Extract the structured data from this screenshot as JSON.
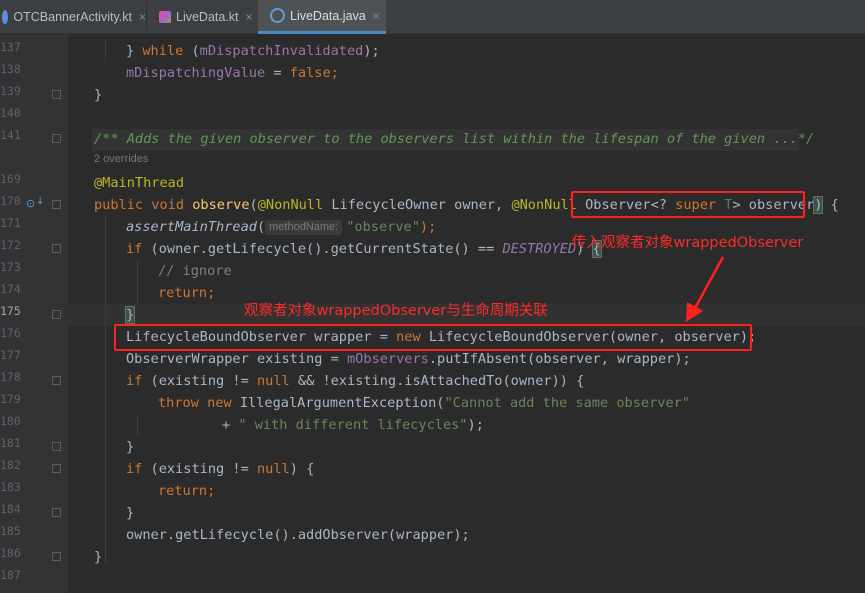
{
  "tabs": [
    {
      "label": "OTCBannerActivity.kt",
      "icon": "kotlin-file-icon",
      "active": false
    },
    {
      "label": "LiveData.kt",
      "icon": "kotlin-file-icon",
      "active": false
    },
    {
      "label": "LiveData.java",
      "icon": "java-class-icon",
      "active": true
    }
  ],
  "tab_close_glyph": "×",
  "line_numbers": [
    "137",
    "138",
    "139",
    "140",
    "141",
    "",
    "169",
    "170",
    "171",
    "172",
    "173",
    "174",
    "175",
    "176",
    "177",
    "178",
    "179",
    "180",
    "181",
    "182",
    "183",
    "184",
    "185",
    "186",
    "187"
  ],
  "current_line": "175",
  "code": {
    "l137": [
      "} ",
      "while",
      " (",
      "mDispatchInvalidated",
      ");"
    ],
    "l138": [
      "mDispatchingValue",
      " = ",
      "false",
      ";"
    ],
    "l139": "}",
    "l141": "/** Adds the given observer to the observers list within the lifespan of the given ...*/",
    "overrides": "2 overrides",
    "l169": "@MainThread",
    "l170": [
      "public void ",
      "observe",
      "(",
      "@NonNull",
      " LifecycleOwner owner, ",
      "@NonNull",
      " ",
      "Observer<? ",
      "super",
      " ",
      "T",
      "> observer",
      ")",
      " {"
    ],
    "l171": [
      "assertMainThread",
      "(",
      "methodName:",
      "\"observe\"",
      ");"
    ],
    "l172": [
      "if",
      " (owner.getLifecycle().getCurrentState() == ",
      "DESTROYED",
      ") ",
      "{"
    ],
    "l173": "// ignore",
    "l174": [
      "return",
      ";"
    ],
    "l175": "}",
    "l176": [
      "LifecycleBoundObserver wrapper = ",
      "new",
      " LifecycleBoundObserver(owner, observer);"
    ],
    "l177": [
      "ObserverWrapper existing = ",
      "mObservers",
      ".putIfAbsent(observer, wrapper);"
    ],
    "l178": [
      "if",
      " (existing != ",
      "null",
      " && !existing.isAttachedTo(owner)) {"
    ],
    "l179": [
      "throw new",
      " IllegalArgumentException(",
      "\"Cannot add the same observer\""
    ],
    "l180": [
      "+ ",
      "\" with different lifecycles\"",
      ");"
    ],
    "l181": "}",
    "l182": [
      "if",
      " (existing != ",
      "null",
      ") {"
    ],
    "l183": [
      "return",
      ";"
    ],
    "l184": "}",
    "l185": "owner.getLifecycle().addObserver(wrapper);",
    "l186": "}"
  },
  "annotations": {
    "note1": "传入观察者对象wrappedObserver",
    "note2": "观察者对象wrappedObserver与生命周期关联"
  },
  "colors": {
    "background": "#2b2b2b",
    "gutter": "#313335",
    "keyword": "#cc7832",
    "string": "#6a8759",
    "field": "#9876aa",
    "method": "#ffc66d",
    "annotation": "#bbb529",
    "highlight_box": "#ff2020"
  }
}
